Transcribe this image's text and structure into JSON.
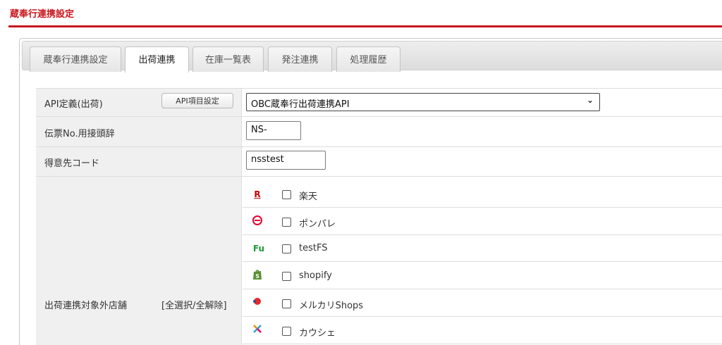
{
  "page": {
    "title": "蔵奉行連携設定"
  },
  "tabs": [
    {
      "label": "蔵奉行連携設定",
      "active": false
    },
    {
      "label": "出荷連携",
      "active": true
    },
    {
      "label": "在庫一覧表",
      "active": false
    },
    {
      "label": "発注連携",
      "active": false
    },
    {
      "label": "処理履歴",
      "active": false
    }
  ],
  "api_definition": {
    "label": "API定義(出荷)",
    "button_label": "API項目設定",
    "selected_value": "OBC蔵奉行出荷連携API",
    "dropdown_icon": "chevron-down-icon"
  },
  "slip_prefix": {
    "label": "伝票No.用接頭辞",
    "value": "NS-"
  },
  "customer_code": {
    "label": "得意先コード",
    "value": "nsstest"
  },
  "excluded_shops": {
    "label": "出荷連携対象外店舗",
    "select_toggle": "[全選択/全解除]",
    "shops": [
      {
        "name": "楽天",
        "icon": "rakuten-icon",
        "checked": false
      },
      {
        "name": "ポンパレ",
        "icon": "ponpare-icon",
        "checked": false
      },
      {
        "name": "testFS",
        "icon": "futureshop-icon",
        "checked": false
      },
      {
        "name": "shopify",
        "icon": "shopify-icon",
        "checked": false
      },
      {
        "name": "メルカリShops",
        "icon": "mercari-shops-icon",
        "checked": false
      },
      {
        "name": "カウシェ",
        "icon": "kauche-icon",
        "checked": false
      }
    ]
  },
  "colors": {
    "accent": "#c8161d",
    "label_bg": "#f0f0f0"
  }
}
